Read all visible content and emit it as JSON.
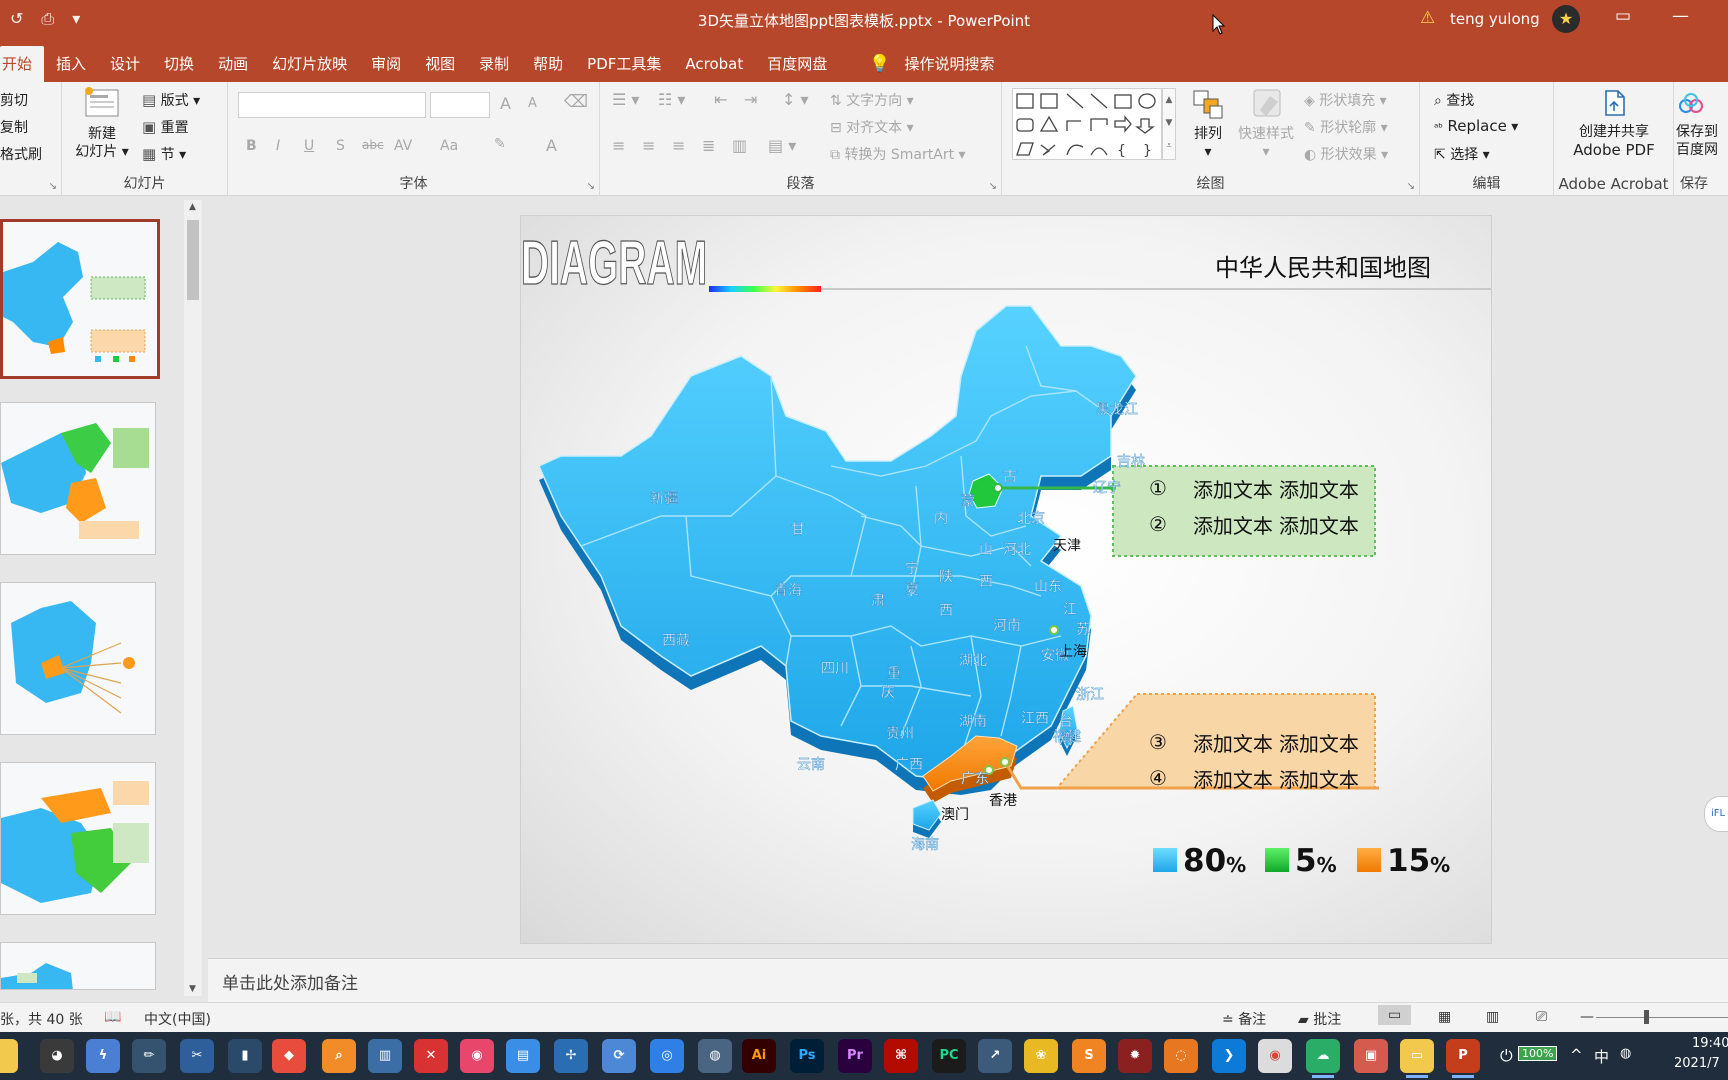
{
  "window": {
    "title": "3D矢量立体地图ppt图表模板.pptx  -  PowerPoint",
    "user": "teng yulong",
    "qat": [
      "↺",
      "⎙",
      "▾"
    ]
  },
  "tabs": [
    {
      "label": "开始",
      "active": true
    },
    {
      "label": "插入"
    },
    {
      "label": "设计"
    },
    {
      "label": "切换"
    },
    {
      "label": "动画"
    },
    {
      "label": "幻灯片放映"
    },
    {
      "label": "审阅"
    },
    {
      "label": "视图"
    },
    {
      "label": "录制"
    },
    {
      "label": "帮助"
    },
    {
      "label": "PDF工具集"
    },
    {
      "label": "Acrobat"
    },
    {
      "label": "百度网盘"
    }
  ],
  "tell_me": "操作说明搜索",
  "ribbon": {
    "clipboard": {
      "cut": "剪切",
      "copy": "复制",
      "format_painter": "格式刷"
    },
    "slides": {
      "new_slide_1": "新建",
      "new_slide_2": "幻灯片",
      "layout": "版式",
      "reset": "重置",
      "section": "节",
      "label": "幻灯片"
    },
    "font": {
      "label": "字体",
      "bold": "B",
      "italic": "I",
      "underline": "U",
      "shadow": "S",
      "strike": "abc",
      "spacing": "AV",
      "case": "Aa",
      "grow": "A",
      "shrink": "A",
      "color": "A"
    },
    "paragraph": {
      "label": "段落",
      "text_direction": "文字方向",
      "align_text": "对齐文本",
      "smartart": "转换为 SmartArt"
    },
    "drawing": {
      "label": "绘图",
      "arrange": "排列",
      "quick_styles": "快速样式",
      "shape_fill": "形状填充",
      "shape_outline": "形状轮廓",
      "shape_effects": "形状效果"
    },
    "editing": {
      "label": "编辑",
      "find": "查找",
      "replace": "Replace",
      "select": "选择"
    },
    "acrobat": {
      "create_1": "创建并共享",
      "create_2": "Adobe PDF",
      "label": "Adobe Acrobat"
    },
    "baidu": {
      "save_1": "保存到",
      "save_2": "百度网",
      "label": "保存"
    }
  },
  "slide": {
    "header_word": "DIAGRAM",
    "title": "中华人民共和国地图",
    "callouts_top": [
      {
        "num": "①",
        "a": "添加文本",
        "b": "添加文本"
      },
      {
        "num": "②",
        "a": "添加文本",
        "b": "添加文本"
      }
    ],
    "callouts_bottom": [
      {
        "num": "③",
        "a": "添加文本",
        "b": "添加文本"
      },
      {
        "num": "④",
        "a": "添加文本",
        "b": "添加文本"
      }
    ],
    "legend": [
      {
        "value": "80",
        "unit": "%",
        "color": "#29b6f0"
      },
      {
        "value": "5",
        "unit": "%",
        "color": "#1fcc3c"
      },
      {
        "value": "15",
        "unit": "%",
        "color": "#ff8a00"
      }
    ],
    "provinces": [
      {
        "name": "新疆"
      },
      {
        "name": "西藏"
      },
      {
        "name": "青海"
      },
      {
        "name": "甘"
      },
      {
        "name": "肃"
      },
      {
        "name": "内"
      },
      {
        "name": "蒙"
      },
      {
        "name": "古"
      },
      {
        "name": "黑龙江"
      },
      {
        "name": "吉林"
      },
      {
        "name": "辽宁"
      },
      {
        "name": "北京"
      },
      {
        "name": "天津"
      },
      {
        "name": "河北"
      },
      {
        "name": "山"
      },
      {
        "name": "西"
      },
      {
        "name": "宁"
      },
      {
        "name": "夏"
      },
      {
        "name": "陕"
      },
      {
        "name": "西"
      },
      {
        "name": "山东"
      },
      {
        "name": "河南"
      },
      {
        "name": "江"
      },
      {
        "name": "苏"
      },
      {
        "name": "安徽"
      },
      {
        "name": "上海"
      },
      {
        "name": "四川"
      },
      {
        "name": "重"
      },
      {
        "name": "庆"
      },
      {
        "name": "湖北"
      },
      {
        "name": "浙江"
      },
      {
        "name": "湖南"
      },
      {
        "name": "江西"
      },
      {
        "name": "贵州"
      },
      {
        "name": "福建"
      },
      {
        "name": "台"
      },
      {
        "name": "湾"
      },
      {
        "name": "云南"
      },
      {
        "name": "广西"
      },
      {
        "name": "广东"
      },
      {
        "name": "香港"
      },
      {
        "name": "澳门"
      },
      {
        "name": "海南"
      }
    ]
  },
  "notes_placeholder": "单击此处添加备注",
  "status": {
    "slide_count": "张，共 40 张",
    "language": "中文(中国)",
    "notes": "备注",
    "comments": "批注"
  },
  "tray": {
    "time": "19:40",
    "date": "2021/7",
    "battery": "100%",
    "ime": "中"
  },
  "taskbar_apps": [
    "Ai",
    "Ps",
    "Pr",
    "PC"
  ]
}
